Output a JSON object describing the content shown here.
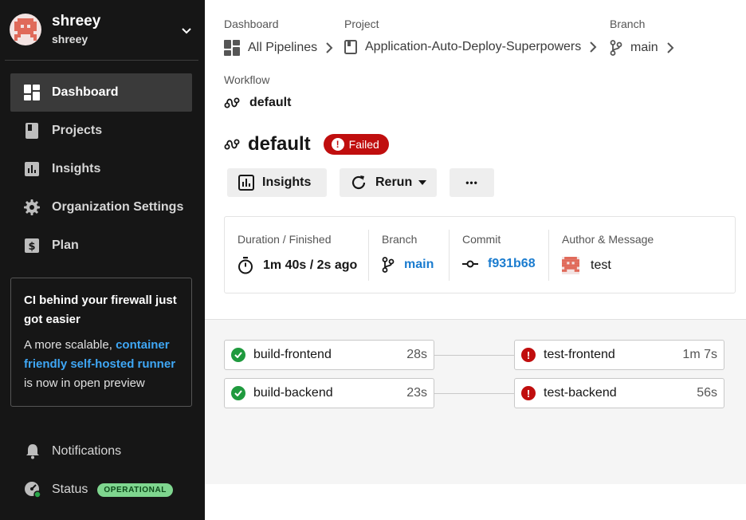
{
  "user": {
    "name": "shreey",
    "org": "shreey"
  },
  "nav": [
    {
      "label": "Dashboard",
      "icon": "dashboard-icon",
      "active": true
    },
    {
      "label": "Projects",
      "icon": "projects-icon"
    },
    {
      "label": "Insights",
      "icon": "insights-icon"
    },
    {
      "label": "Organization Settings",
      "icon": "gear-icon"
    },
    {
      "label": "Plan",
      "icon": "dollar-icon"
    }
  ],
  "promo": {
    "title": "CI behind your firewall just got easier",
    "body_prefix": "A more scalable, ",
    "link": "container friendly self-hosted runner",
    "body_suffix": " is now in open preview"
  },
  "bottom": {
    "notifications": "Notifications",
    "status": "Status",
    "status_badge": "OPERATIONAL"
  },
  "breadcrumbs": [
    {
      "label": "Dashboard",
      "value": "All Pipelines"
    },
    {
      "label": "Project",
      "value": "Application-Auto-Deploy-Superpowers"
    },
    {
      "label": "Branch",
      "value": "main"
    }
  ],
  "workflow": {
    "label": "Workflow",
    "value": "default"
  },
  "title": {
    "name": "default",
    "status": "Failed"
  },
  "buttons": {
    "insights": "Insights",
    "rerun": "Rerun",
    "more": "•••"
  },
  "summary": {
    "duration_label": "Duration / Finished",
    "duration_value": "1m 40s / 2s ago",
    "branch_label": "Branch",
    "branch_value": "main",
    "commit_label": "Commit",
    "commit_value": "f931b68",
    "author_label": "Author & Message",
    "author_message": "test"
  },
  "jobs": [
    {
      "name": "build-frontend",
      "duration": "28s",
      "status": "success"
    },
    {
      "name": "build-backend",
      "duration": "23s",
      "status": "success"
    },
    {
      "name": "test-frontend",
      "duration": "1m 7s",
      "status": "failed"
    },
    {
      "name": "test-backend",
      "duration": "56s",
      "status": "failed"
    }
  ],
  "colors": {
    "failed": "#c00e0e",
    "success": "#1f9a3e",
    "link": "#1b7ccf",
    "sidebar_bg": "#161616"
  }
}
